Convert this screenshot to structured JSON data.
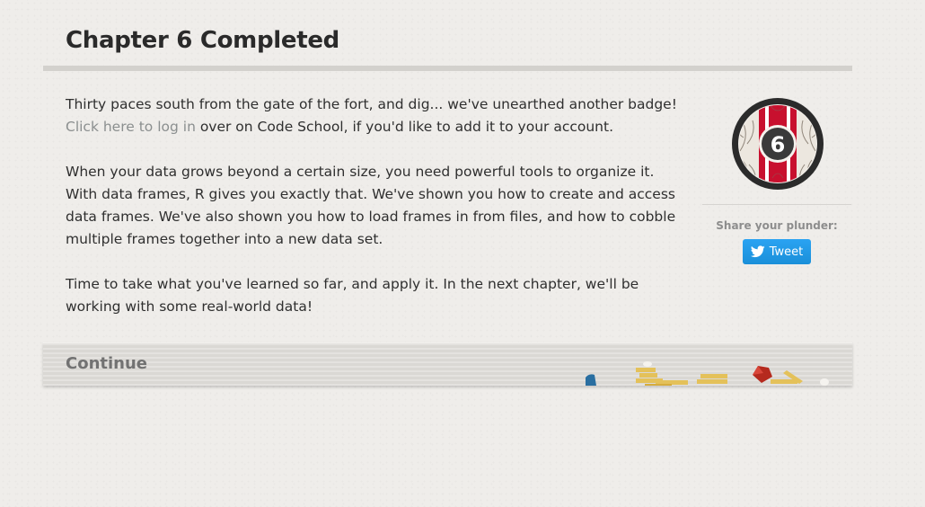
{
  "page": {
    "title": "Chapter 6 Completed"
  },
  "content": {
    "p1_before_link": "Thirty paces south from the gate of the fort, and dig... we've unearthed another badge! ",
    "p1_link": "Click here to log in",
    "p1_after_link": " over on Code School, if you'd like to add it to your account.",
    "p2": "When your data grows beyond a certain size, you need powerful tools to organize it. With data frames, R gives you exactly that. We've shown you how to create and access data frames. We've also shown you how to load frames in from files, and how to cobble multiple frames together into a new data set.",
    "p3": "Time to take what you've learned so far, and apply it. In the next chapter, we'll be working with some real-world data!"
  },
  "badge": {
    "number": "6",
    "icon": "chapter-badge-icon",
    "colors": {
      "ring": "#2b2b2b",
      "stripe": "#c8102e",
      "center": "#3a3a3a"
    }
  },
  "share": {
    "label": "Share your plunder:",
    "tweet_label": "Tweet",
    "tweet_color": "#1d9bf0"
  },
  "continue": {
    "label": "Continue"
  },
  "colors": {
    "background": "#efedea",
    "link": "#8b8f8f",
    "rule": "#d3d1cd"
  }
}
